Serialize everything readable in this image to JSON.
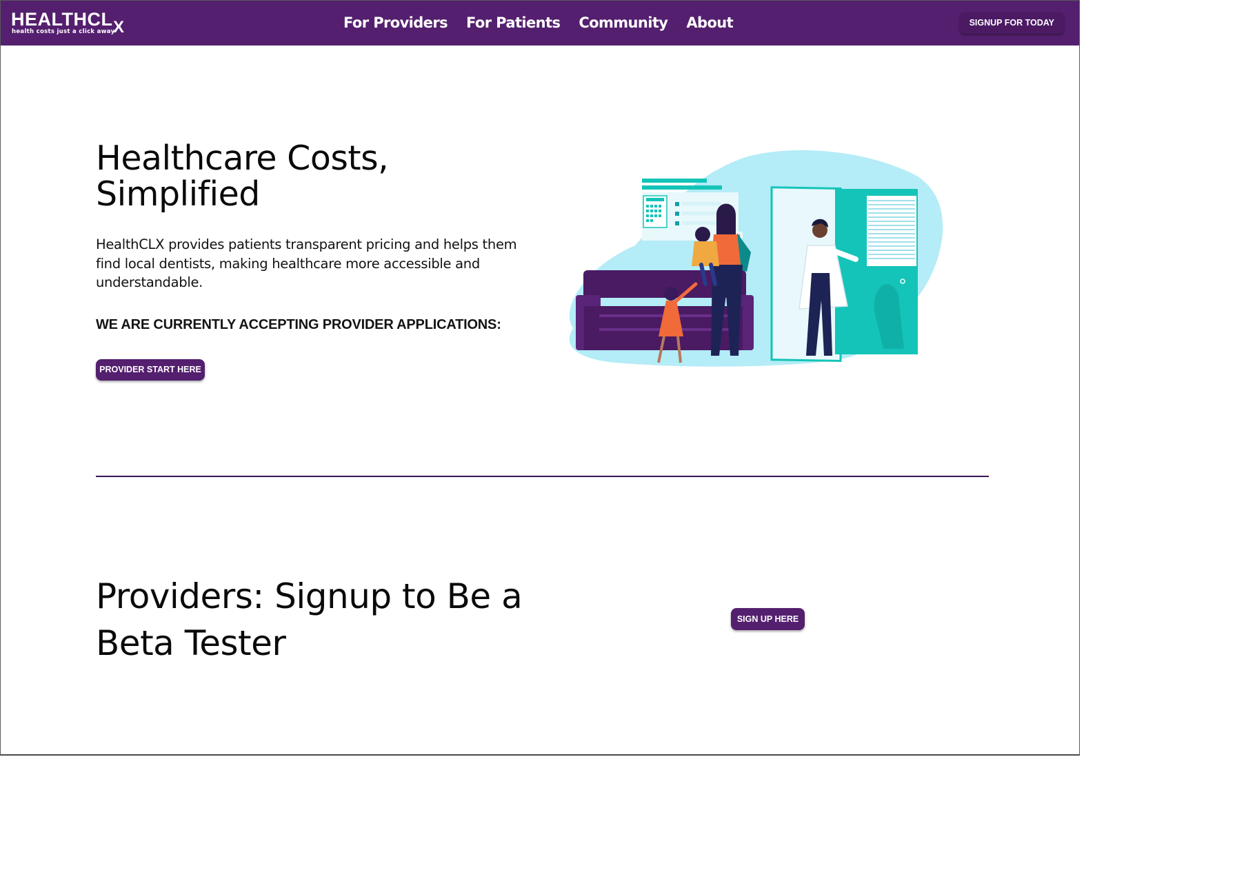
{
  "header": {
    "logo_text": "HEALTHCL",
    "logo_x": "X",
    "logo_tagline": "health costs just a click away",
    "nav": [
      {
        "label": "For Providers"
      },
      {
        "label": "For Patients"
      },
      {
        "label": "Community"
      },
      {
        "label": "About"
      }
    ],
    "cta_label": "SIGNUP FOR TODAY"
  },
  "hero": {
    "title_line1": "Healthcare Costs,",
    "title_line2": "Simplified",
    "description": "HealthCLX provides patients transparent pricing and helps them find local dentists, making healthcare more accessible and understandable.",
    "accepting_text": "WE ARE CURRENTLY ACCEPTING PROVIDER APPLICATIONS:",
    "button_label": "PROVIDER START HERE",
    "illustration": "family-with-doctor-illustration"
  },
  "beta": {
    "title": "Providers: Signup to Be a Beta Tester",
    "button_label": "SIGN UP HERE"
  },
  "colors": {
    "brand_purple": "#541f6e",
    "illustration_teal": "#14c4b8",
    "illustration_light_blue": "#b4ecf7"
  }
}
